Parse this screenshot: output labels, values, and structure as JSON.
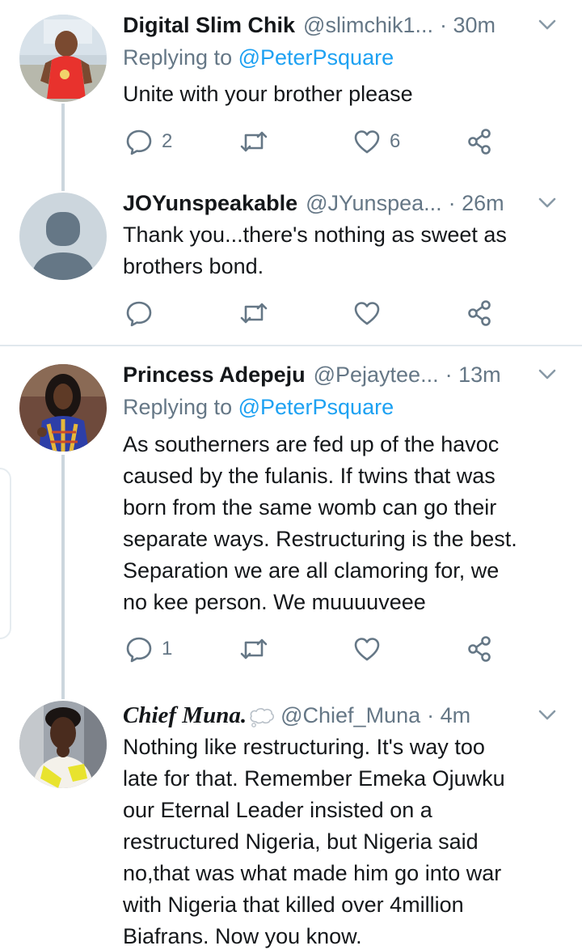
{
  "tweets": [
    {
      "name": "Digital Slim Chik",
      "handle": "@slimchik1...",
      "time": "· 30m",
      "reply_prefix": "Replying to ",
      "reply_to": "@PeterPsquare",
      "lines": [
        "Unite with your brother please"
      ],
      "replies": "2",
      "retweets": "",
      "likes": "6"
    },
    {
      "name": "JOYunspeakable",
      "handle": "@JYunspea...",
      "time": "· 26m",
      "lines": [
        "Thank you...there's nothing as sweet as",
        "brothers bond."
      ],
      "replies": "",
      "retweets": "",
      "likes": ""
    },
    {
      "name": "Princess Adepeju",
      "handle": "@Pejaytee...",
      "time": "· 13m",
      "reply_prefix": "Replying to ",
      "reply_to": "@PeterPsquare",
      "lines": [
        "As southerners are fed up of the havoc",
        "caused by the fulanis. If twins that was",
        "born from the same womb can go their",
        "separate ways.  Restructuring is the best.",
        "Separation we are all clamoring for, we",
        "no kee person. We muuuuveee"
      ],
      "replies": "1",
      "retweets": "",
      "likes": ""
    },
    {
      "name": "Chief Muna.",
      "handle": "@Chief_Muna",
      "time": "· 4m",
      "lines": [
        "Nothing like restructuring. It's way too",
        "late for that. Remember Emeka Ojuwku",
        "our Eternal Leader insisted on a",
        "restructured Nigeria, but Nigeria said",
        "no,that was what made him go into war",
        "with Nigeria that killed over 4million",
        "Biafrans. Now you know."
      ]
    }
  ],
  "icons": {
    "reply": "reply-icon",
    "retweet": "retweet-icon",
    "like": "heart-icon",
    "share": "share-icon",
    "caret": "chevron-down-icon",
    "thought": "thought-bubble-emoji"
  },
  "colors": {
    "link": "#1da1f2",
    "muted": "#657786",
    "text": "#14171a",
    "thread_line": "#ccd6dd",
    "divider": "#e1e8ed"
  }
}
